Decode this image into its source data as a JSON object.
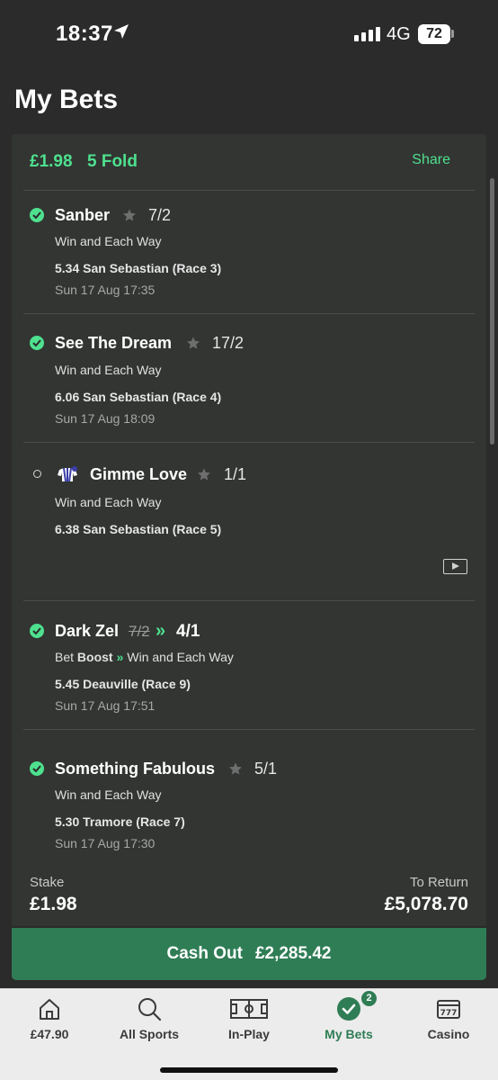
{
  "status_bar": {
    "time": "18:37",
    "network": "4G",
    "battery": "72"
  },
  "page": {
    "title": "My Bets"
  },
  "bet": {
    "stake_header": "£1.98",
    "type": "5 Fold",
    "share_label": "Share",
    "legs": [
      {
        "name": "Sanber",
        "odds": "7/2",
        "market": "Win and Each Way",
        "race": "5.34 San Sebastian (Race 3)",
        "datetime": "Sun 17 Aug 17:35",
        "status": "won"
      },
      {
        "name": "See The Dream",
        "odds": "17/2",
        "market": "Win and Each Way",
        "race": "6.06 San Sebastian (Race 4)",
        "datetime": "Sun 17 Aug 18:09",
        "status": "won"
      },
      {
        "name": "Gimme Love",
        "odds": "1/1",
        "market": "Win and Each Way",
        "race": "6.38 San Sebastian (Race 5)",
        "status": "open"
      },
      {
        "name": "Dark Zel",
        "old_odds": "7/2",
        "odds": "4/1",
        "boost_prefix": "Bet",
        "boost_word": "Boost",
        "market": "Win and Each Way",
        "race": "5.45 Deauville (Race 9)",
        "datetime": "Sun 17 Aug 17:51",
        "status": "won"
      },
      {
        "name": "Something Fabulous",
        "odds": "5/1",
        "market": "Win and Each Way",
        "race": "5.30 Tramore (Race 7)",
        "datetime": "Sun 17 Aug 17:30",
        "status": "won"
      }
    ],
    "stake_label": "Stake",
    "stake_value": "£1.98",
    "return_label": "To Return",
    "return_value": "£5,078.70",
    "cashout_label": "Cash Out",
    "cashout_value": "£2,285.42"
  },
  "tabbar": {
    "balance": "£47.90",
    "all_sports": "All Sports",
    "in_play": "In-Play",
    "my_bets": "My Bets",
    "my_bets_badge": "2",
    "casino": "Casino"
  },
  "colors": {
    "accent": "#4ee08e",
    "brand_green": "#2f7d55",
    "background": "#2b2b2b",
    "card": "#323532"
  }
}
